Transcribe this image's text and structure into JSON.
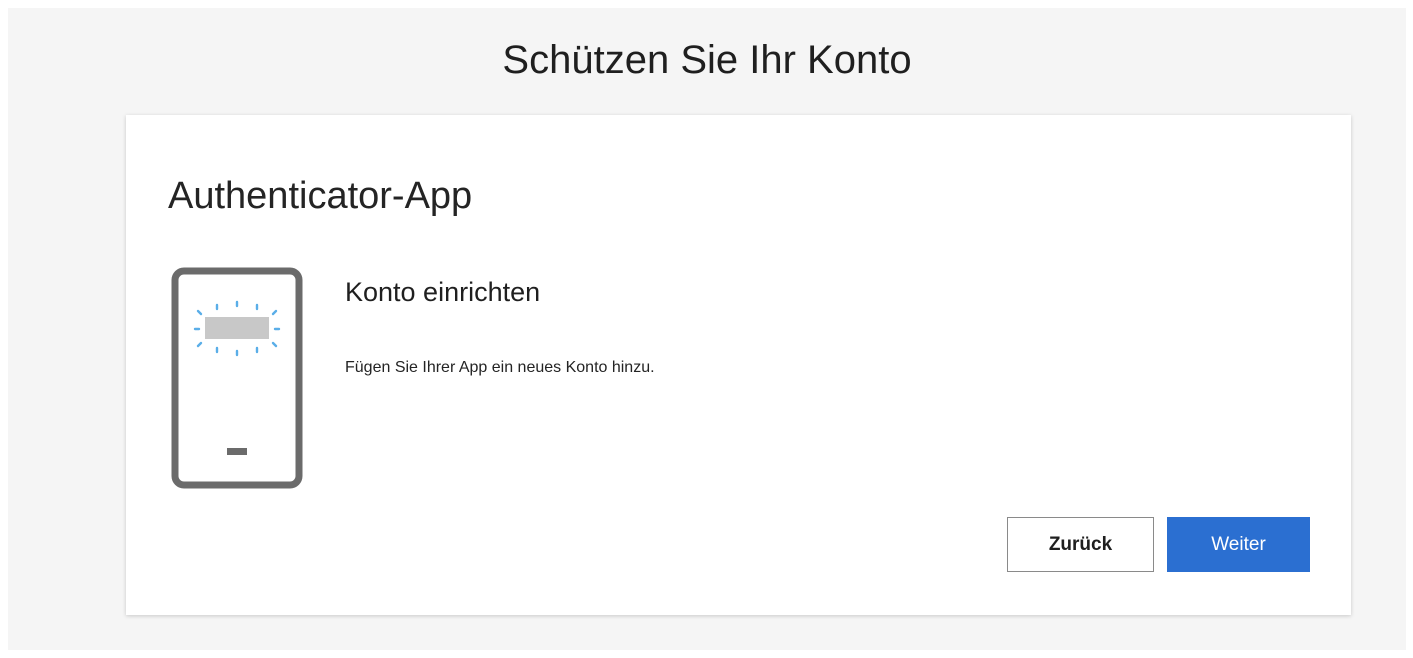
{
  "page": {
    "title": "Schützen Sie Ihr Konto"
  },
  "card": {
    "title": "Authenticator-App",
    "illustration_icon": "phone-notification-icon",
    "step_title": "Konto einrichten",
    "step_description": "Fügen Sie Ihrer App ein neues Konto hinzu."
  },
  "buttons": {
    "back_label": "Zurück",
    "next_label": "Weiter"
  },
  "colors": {
    "background": "#f5f5f5",
    "card": "#ffffff",
    "accent": "#2b6fd1",
    "phone_frame": "#6b6b6b",
    "notification_rays": "#5aaee8"
  }
}
